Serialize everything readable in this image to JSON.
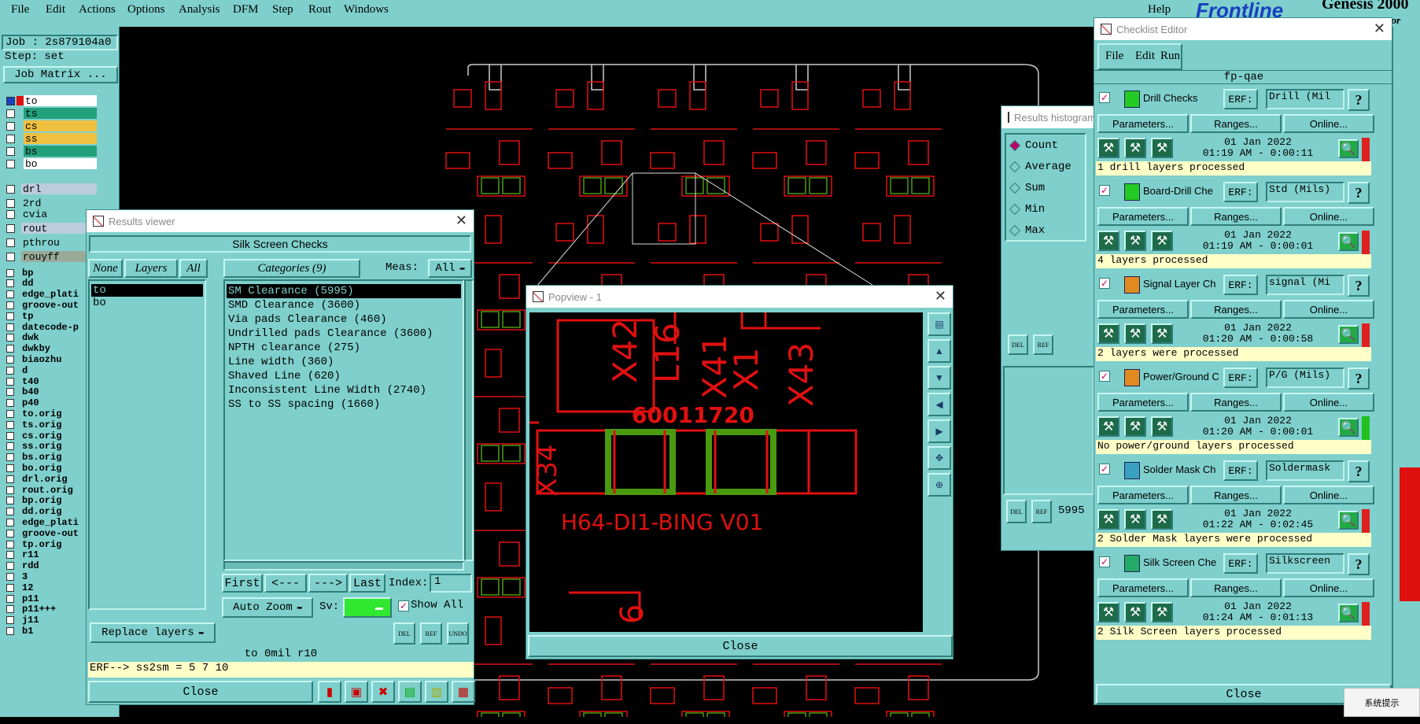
{
  "menubar": {
    "items": [
      "File",
      "Edit",
      "Actions",
      "Options",
      "Analysis",
      "DFM",
      "Step",
      "Rout",
      "Windows"
    ],
    "help": "Help",
    "brand": "Frontline",
    "brand2": "Genesis 2000",
    "tagline": "tor"
  },
  "job": {
    "job": "Job : 2s879104a0",
    "step": "Step: set",
    "matrix": "Job Matrix ..."
  },
  "layers_top": [
    {
      "name": "to",
      "color": "#ffffff"
    },
    {
      "name": "ts",
      "color": "#22a07a"
    },
    {
      "name": "cs",
      "color": "#f0c040"
    },
    {
      "name": "ss",
      "color": "#f0c040"
    },
    {
      "name": "bs",
      "color": "#22a07a"
    },
    {
      "name": "bo",
      "color": "#ffffff"
    }
  ],
  "layers_mid": [
    "drl",
    "2rd",
    "cvia",
    "rout",
    "pthrou",
    "rouyff"
  ],
  "layers_list": [
    "bp",
    "dd",
    "edge_plati",
    "groove-out",
    "tp",
    "datecode-p",
    "dwk",
    "dwkby",
    "biaozhu",
    "d",
    "t40",
    "b40",
    "p40",
    "to.orig",
    "ts.orig",
    "cs.orig",
    "ss.orig",
    "bs.orig",
    "bo.orig",
    "drl.orig",
    "rout.orig",
    "bp.orig",
    "dd.orig",
    "edge_plati",
    "groove-out",
    "tp.orig",
    "r11",
    "rdd",
    "3",
    "12",
    "p11",
    "p11+++",
    "j11",
    "b1"
  ],
  "results_viewer": {
    "title": "Results viewer",
    "header": "Silk Screen Checks",
    "none": "None",
    "layers": "Layers",
    "all": "All",
    "categories": "Categories (9)",
    "meas": "Meas:",
    "meas_value": "All",
    "layers_items": [
      "to",
      "bo"
    ],
    "category_items": [
      "SM Clearance (5995)",
      "SMD Clearance (3600)",
      "Via pads Clearance (460)",
      "Undrilled pads Clearance (3600)",
      "NPTH clearance (275)",
      "Line width (360)",
      "Shaved Line (620)",
      "Inconsistent Line Width (2740)",
      "SS to SS spacing (1660)"
    ],
    "first": "First",
    "prev": "<---",
    "next": "--->",
    "last": "Last",
    "index_label": "Index:",
    "index_value": "1",
    "auto_zoom": "Auto Zoom",
    "sv": "Sv:",
    "show_all": "Show All",
    "replace": "Replace layers",
    "status": "to 0mil  r10",
    "erf": "ERF--> ss2sm = 5 7 10",
    "close": "Close"
  },
  "popview": {
    "title": "Popview - 1",
    "close": "Close",
    "texts": {
      "x42": "X42",
      "x41": "X41",
      "x1": "X1",
      "x43": "X43",
      "l16": "L16",
      "num": "60011720",
      "h64": "H64-DI1-BING V01",
      "x34": "X34",
      "six": "6"
    }
  },
  "histogram": {
    "title": "Results histogram",
    "options": [
      "Count",
      "Average",
      "Sum",
      "Min",
      "Max"
    ],
    "count_value": "5995"
  },
  "checklist": {
    "title": "Checklist Editor",
    "menu": [
      "File",
      "Edit",
      "Run"
    ],
    "name": "fp-qae",
    "erf": "ERF:",
    "params": "Parameters...",
    "ranges": "Ranges...",
    "online": "Online...",
    "close": "Close",
    "checks": [
      {
        "name": "Drill Checks",
        "erf_value": "Drill (Mil",
        "date": "01 Jan 2022",
        "time": "01:19 AM - 0:00:11",
        "status": "1 drill layers processed",
        "flag": "#e02020"
      },
      {
        "name": "Board-Drill Che",
        "erf_value": "Std (Mils)",
        "date": "01 Jan 2022",
        "time": "01:19 AM - 0:00:01",
        "status": "4 layers processed",
        "flag": "#e02020"
      },
      {
        "name": "Signal Layer Ch",
        "erf_value": "signal (Mi",
        "date": "01 Jan 2022",
        "time": "01:20 AM - 0:00:58",
        "status": "2 layers were processed",
        "flag": "#e02020"
      },
      {
        "name": "Power/Ground C",
        "erf_value": "P/G (Mils)",
        "date": "01 Jan 2022",
        "time": "01:20 AM - 0:00:01",
        "status": "No power/ground layers processed",
        "flag": "#20c020"
      },
      {
        "name": "Solder Mask Ch",
        "erf_value": "Soldermask",
        "date": "01 Jan 2022",
        "time": "01:22 AM - 0:02:45",
        "status": "2 Solder Mask layers were processed",
        "flag": "#e02020"
      },
      {
        "name": "Silk Screen Che",
        "erf_value": "Silkscreen",
        "date": "01 Jan 2022",
        "time": "01:24 AM - 0:01:13",
        "status": "2 Silk Screen layers processed",
        "flag": "#e02020"
      }
    ]
  },
  "tray": {
    "text": "系统提示"
  },
  "colors": {
    "teal": "#7fd0cc",
    "pcb_red": "#e01010",
    "pad_green": "#4a9a10"
  }
}
